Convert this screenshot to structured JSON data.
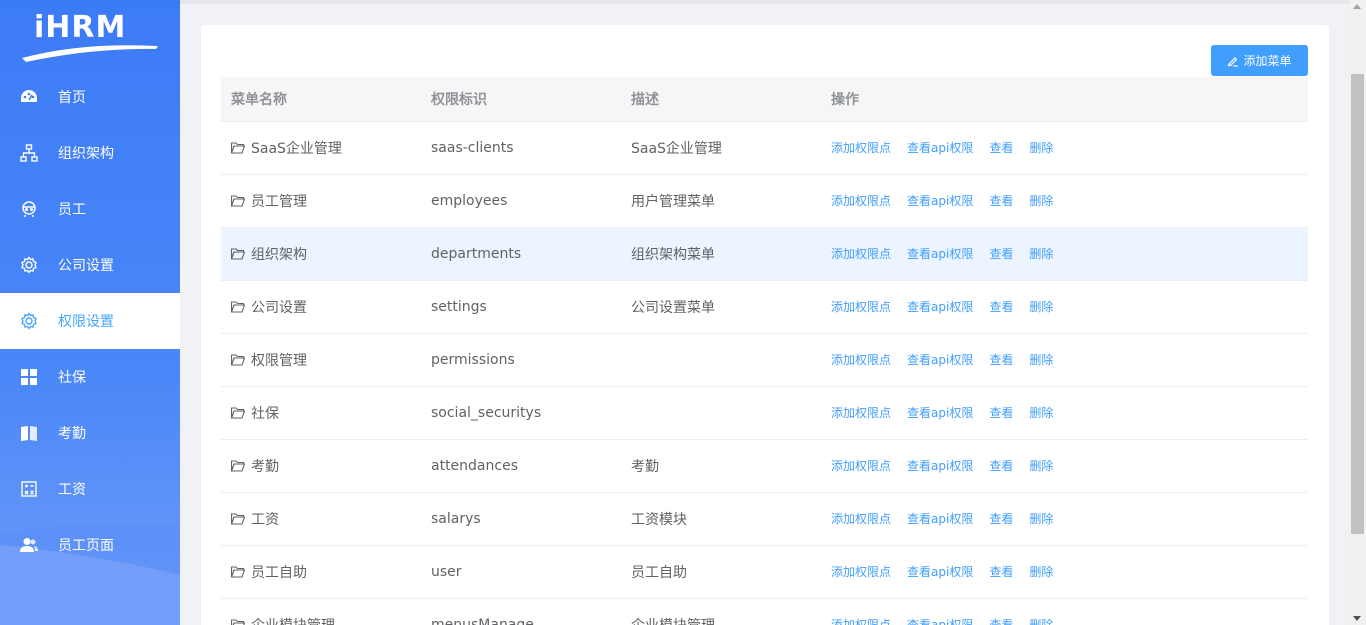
{
  "brand": {
    "logo_text": "iHRM",
    "accent": "#409eff",
    "sidebar_color": "#3c7bf6"
  },
  "sidebar": {
    "items": [
      {
        "label": "首页",
        "icon": "dashboard-icon"
      },
      {
        "label": "组织架构",
        "icon": "org-tree-icon"
      },
      {
        "label": "员工",
        "icon": "employee-icon"
      },
      {
        "label": "公司设置",
        "icon": "gear-icon"
      },
      {
        "label": "权限设置",
        "icon": "gear-icon",
        "active": true
      },
      {
        "label": "社保",
        "icon": "grid-icon"
      },
      {
        "label": "考勤",
        "icon": "book-icon"
      },
      {
        "label": "工资",
        "icon": "calculator-icon"
      },
      {
        "label": "员工页面",
        "icon": "users-icon"
      }
    ]
  },
  "toolbar": {
    "add_menu_label": "添加菜单"
  },
  "table": {
    "headers": [
      "菜单名称",
      "权限标识",
      "描述",
      "操作"
    ],
    "actions": [
      "添加权限点",
      "查看api权限",
      "查看",
      "删除"
    ],
    "rows": [
      {
        "name": "SaaS企业管理",
        "code": "saas-clients",
        "desc": "SaaS企业管理"
      },
      {
        "name": "员工管理",
        "code": "employees",
        "desc": "用户管理菜单"
      },
      {
        "name": "组织架构",
        "code": "departments",
        "desc": "组织架构菜单"
      },
      {
        "name": "公司设置",
        "code": "settings",
        "desc": "公司设置菜单"
      },
      {
        "name": "权限管理",
        "code": "permissions",
        "desc": ""
      },
      {
        "name": "社保",
        "code": "social_securitys",
        "desc": ""
      },
      {
        "name": "考勤",
        "code": "attendances",
        "desc": "考勤"
      },
      {
        "name": "工资",
        "code": "salarys",
        "desc": "工资模块"
      },
      {
        "name": "员工自助",
        "code": "user",
        "desc": "员工自助"
      },
      {
        "name": "企业模块管理",
        "code": "menusManage",
        "desc": "企业模块管理"
      }
    ]
  }
}
